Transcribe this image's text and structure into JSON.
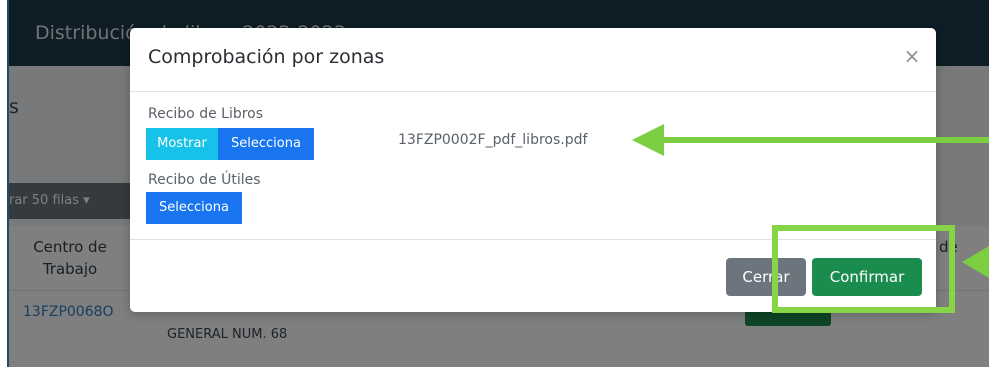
{
  "app": {
    "title": "Distribución de libros 2022-2023",
    "page_heading": "s",
    "rows_dropdown": "rar 50 filas",
    "table": {
      "col_center_line1": "Centro de",
      "col_center_line2": "Trabajo",
      "col_right_partial": "de",
      "row_code": "13FZP0068O",
      "row_name": "GENERAL NUM. 68"
    }
  },
  "modal": {
    "title": "Comprobación por zonas",
    "close_symbol": "×",
    "libros_label": "Recibo de Libros",
    "mostrar_label": "Mostrar",
    "selecciona_label": "Selecciona",
    "file_name": "13FZP0002F_pdf_libros.pdf",
    "utiles_label": "Recibo de Útiles",
    "selecciona_utiles_label": "Selecciona",
    "cerrar_label": "Cerrar",
    "confirmar_label": "Confirmar"
  },
  "annotation": {
    "color": "#7ccf40"
  },
  "icons": [
    "close-icon",
    "caret-down-icon"
  ]
}
